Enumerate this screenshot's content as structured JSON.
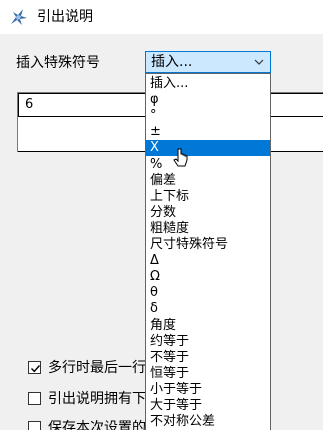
{
  "window": {
    "title": "引出说明"
  },
  "insert": {
    "label": "插入特殊符号",
    "combo_value": "插入..."
  },
  "text_area": {
    "line1": "6"
  },
  "dropdown": {
    "items": [
      "插入...",
      "φ",
      "°",
      "±",
      "X",
      "%",
      "偏差",
      "上下标",
      "分数",
      "粗糙度",
      "尺寸特殊符号",
      "Δ",
      "Ω",
      "θ",
      "δ",
      "角度",
      "约等于",
      "不等于",
      "恒等于",
      "小于等于",
      "大于等于",
      "不对称公差"
    ],
    "selected_index": 4
  },
  "options": {
    "cb1_label": "多行时最后一行",
    "cb1_checked": true,
    "cb2_label": "引出说明拥有下",
    "cb2_checked": false,
    "cb3_label": "保存本次设置的",
    "cb3_checked": false
  },
  "colors": {
    "selection": "#0078d7",
    "combo_bg": "#cce8ff",
    "dialog_bg": "#f0f0f0"
  }
}
